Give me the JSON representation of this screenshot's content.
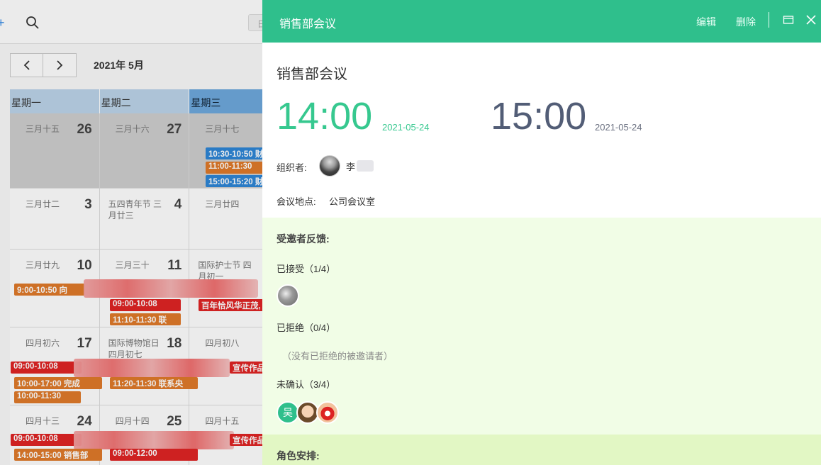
{
  "calendar": {
    "month_label": "2021年 5月",
    "view_button": "日",
    "weekdays": [
      "星期一",
      "星期二",
      "星期三"
    ],
    "weeks": [
      {
        "days": [
          {
            "lunar": "三月十五",
            "num": "26"
          },
          {
            "lunar": "三月十六",
            "num": "27"
          },
          {
            "lunar": "三月十七",
            "num": ""
          }
        ]
      },
      {
        "days": [
          {
            "lunar": "三月廿二",
            "num": "3"
          },
          {
            "lunar": "五四青年节 三月廿三",
            "num": "4"
          },
          {
            "lunar": "三月廿四",
            "num": ""
          }
        ]
      },
      {
        "days": [
          {
            "lunar": "三月廿九",
            "num": "10"
          },
          {
            "lunar": "三月三十",
            "num": "11"
          },
          {
            "lunar": "国际护士节 四月初一",
            "num": ""
          }
        ]
      },
      {
        "days": [
          {
            "lunar": "四月初六",
            "num": "17"
          },
          {
            "lunar": "国际博物馆日 四月初七",
            "num": "18"
          },
          {
            "lunar": "四月初八",
            "num": ""
          }
        ]
      },
      {
        "days": [
          {
            "lunar": "四月十三",
            "num": "24"
          },
          {
            "lunar": "四月十四",
            "num": "25"
          },
          {
            "lunar": "四月十五",
            "num": ""
          }
        ]
      }
    ],
    "events": {
      "w1_a": "10:30-10:50 财",
      "w1_b": "11:00-11:30",
      "w1_c": "15:00-15:20 财",
      "w3_a": "9:00-10:50 向",
      "w3_b": "09:00-10:08",
      "w3_b_tail": "百年恰风华正茂,",
      "w3_c": "11:10-11:30 联",
      "w4_a": "09:00-10:08",
      "w4_a_tail": "宣传作品",
      "w4_b": "10:00-17:00 完成",
      "w4_c": "11:20-11:30 联系央",
      "w4_d": "10:00-11:30",
      "w5_a": "09:00-10:08",
      "w5_a_tail": "宣传作品",
      "w5_b": "14:00-15:00 销售部",
      "w5_c": "09:00-12:00"
    }
  },
  "panel": {
    "header_title": "销售部会议",
    "edit_label": "编辑",
    "delete_label": "删除",
    "title": "销售部会议",
    "start_time": "14:00",
    "start_date": "2021-05-24",
    "end_time": "15:00",
    "end_date": "2021-05-24",
    "organizer_label": "组织者:",
    "organizer_name": "李",
    "location_label": "会议地点:",
    "location_value": "公司会议室",
    "feedback_title": "受邀者反馈:",
    "accepted_label": "已接受（1/4）",
    "rejected_label": "已拒绝（0/4）",
    "rejected_empty": "（没有已拒绝的被邀请者）",
    "unconfirmed_label": "未确认（3/4）",
    "unconfirmed_avatar_text": "吴",
    "roles_title": "角色安排:"
  },
  "colors": {
    "header_green": "#2fbf8c",
    "start_time_green": "#36c88f",
    "end_time_slate": "#525d76",
    "feedback_bg": "#f1fde6"
  }
}
